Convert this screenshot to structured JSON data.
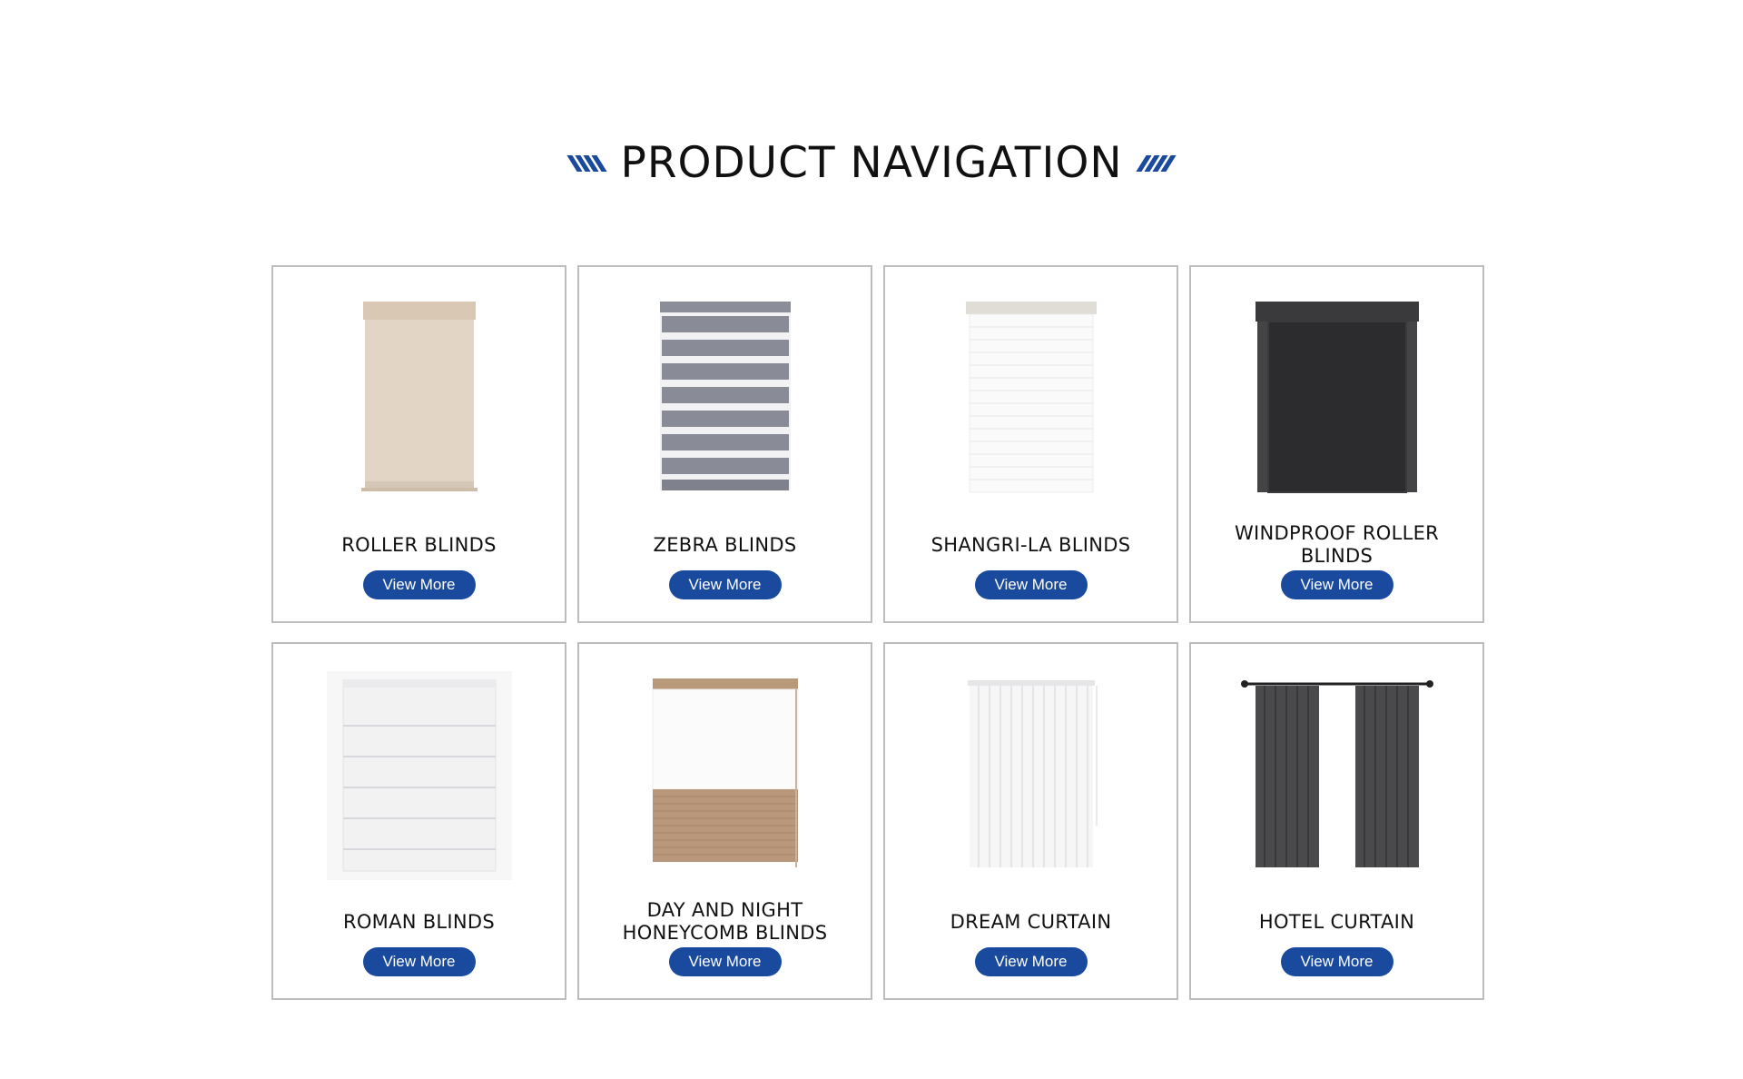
{
  "heading": {
    "title": "PRODUCT NAVIGATION"
  },
  "colors": {
    "accent": "#1a4a9e",
    "border": "#bdbdbd",
    "text": "#111111"
  },
  "products": [
    {
      "name": "ROLLER BLINDS",
      "button": "View More",
      "image": "roller-blind-image"
    },
    {
      "name": "ZEBRA BLINDS",
      "button": "View More",
      "image": "zebra-blind-image"
    },
    {
      "name": "SHANGRI-LA BLINDS",
      "button": "View More",
      "image": "shangri-la-blind-image"
    },
    {
      "name": "WINDPROOF ROLLER BLINDS",
      "button": "View More",
      "image": "windproof-roller-blind-image"
    },
    {
      "name": "ROMAN BLINDS",
      "button": "View More",
      "image": "roman-blind-image"
    },
    {
      "name": "DAY AND NIGHT HONEYCOMB BLINDS",
      "button": "View More",
      "image": "honeycomb-blind-image"
    },
    {
      "name": "DREAM CURTAIN",
      "button": "View More",
      "image": "dream-curtain-image"
    },
    {
      "name": "HOTEL CURTAIN",
      "button": "View More",
      "image": "hotel-curtain-image"
    }
  ]
}
